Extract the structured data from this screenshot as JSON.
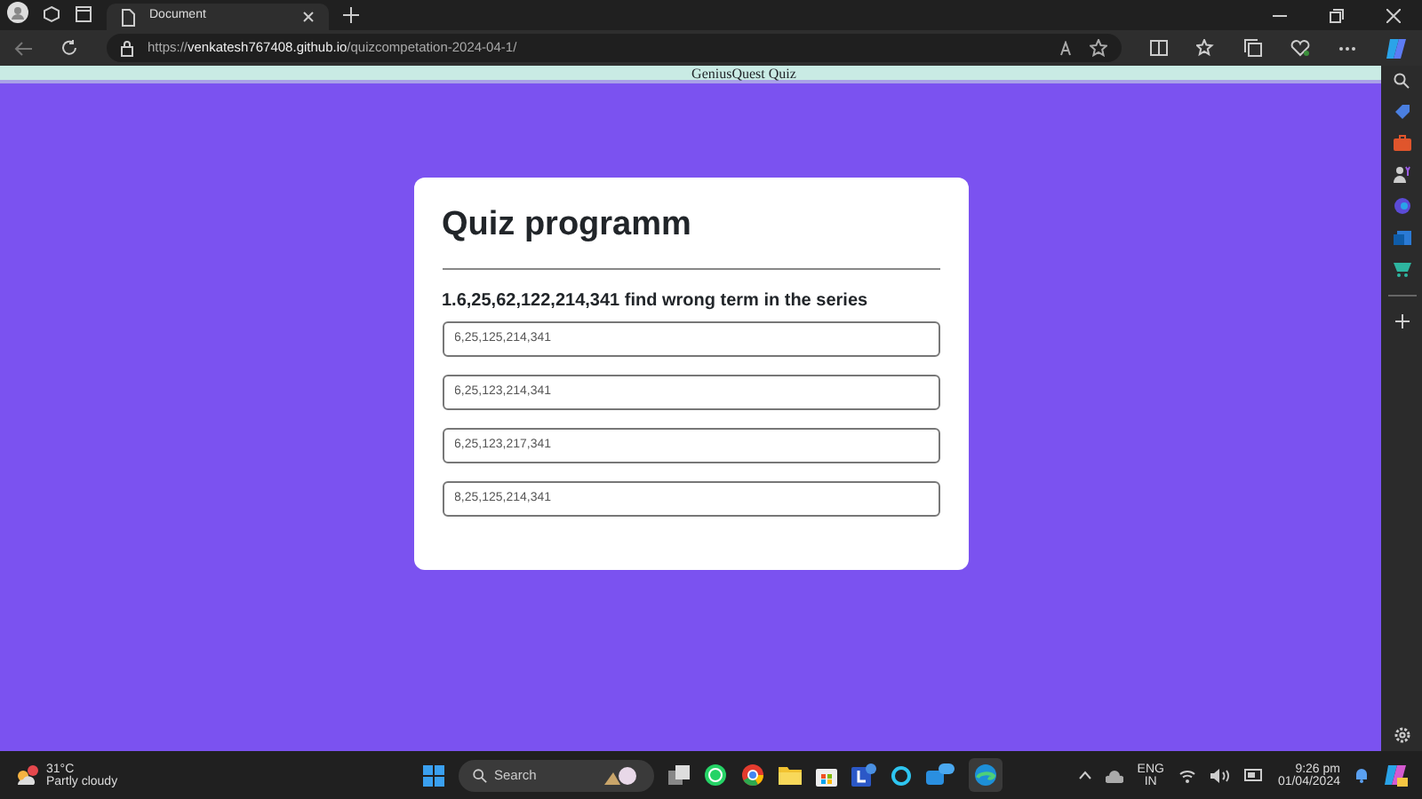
{
  "browser": {
    "tab_title": "Document",
    "url_scheme": "https://",
    "url_host": "venkatesh767408.github.io",
    "url_path": "/quizcompetation-2024-04-1/"
  },
  "page": {
    "header": "GeniusQuest Quiz",
    "title": "Quiz programm",
    "question": "1.6,25,62,122,214,341 find wrong term in the series",
    "options": [
      {
        "placeholder": "6,25,125,214,341"
      },
      {
        "placeholder": "6,25,123,214,341"
      },
      {
        "placeholder": "6,25,123,217,341"
      },
      {
        "placeholder": "8,25,125,214,341"
      }
    ]
  },
  "taskbar": {
    "temperature": "31°C",
    "weather": "Partly cloudy",
    "search_placeholder": "Search",
    "language": "ENG",
    "region": "IN",
    "time": "9:26 pm",
    "date": "01/04/2024"
  }
}
